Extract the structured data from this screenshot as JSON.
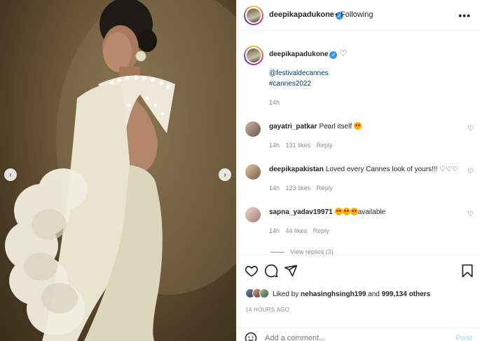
{
  "post": {
    "author": "deepikapadukone",
    "separator": "•",
    "follow_status": "Following",
    "more_label": "•••",
    "caption": {
      "author": "deepikapadukone",
      "heart": "♡",
      "mention": "@festivaldecannes",
      "hashtag": "#cannes2022",
      "time": "14h"
    },
    "comments": [
      {
        "user": "gayatri_patkar",
        "text": "Pearl itself",
        "time": "14h",
        "likes": "131 likes",
        "reply": "Reply",
        "heart": "♡"
      },
      {
        "user": "deepikapakistan",
        "text": "Loved every Cannes look of yours!!! ♡♡♡",
        "time": "14h",
        "likes": "123 likes",
        "reply": "Reply",
        "heart": "♡"
      },
      {
        "user": "sapna_yadav19971",
        "text": "available",
        "time": "14h",
        "likes": "44 likes",
        "reply": "Reply",
        "heart": "♡"
      }
    ],
    "view_replies": "View replies (3)",
    "liked_by_prefix": "Liked by ",
    "liked_by_user": "nehasinghsingh199",
    "liked_by_and": " and ",
    "liked_by_others": "999,134 others",
    "posted_ago": "14 HOURS AGO",
    "comment_placeholder": "Add a comment...",
    "post_label": "Post"
  },
  "media": {
    "prev_label": "‹",
    "next_label": "›"
  },
  "colors": {
    "link": "#00376b",
    "verified": "#3897f0",
    "post_button_disabled": "#b2dffc",
    "muted": "#8e8e8e"
  },
  "icons": [
    "heart-icon",
    "comment-icon",
    "share-icon",
    "bookmark-icon",
    "emoji-icon",
    "verified-badge-icon",
    "more-options-icon"
  ]
}
